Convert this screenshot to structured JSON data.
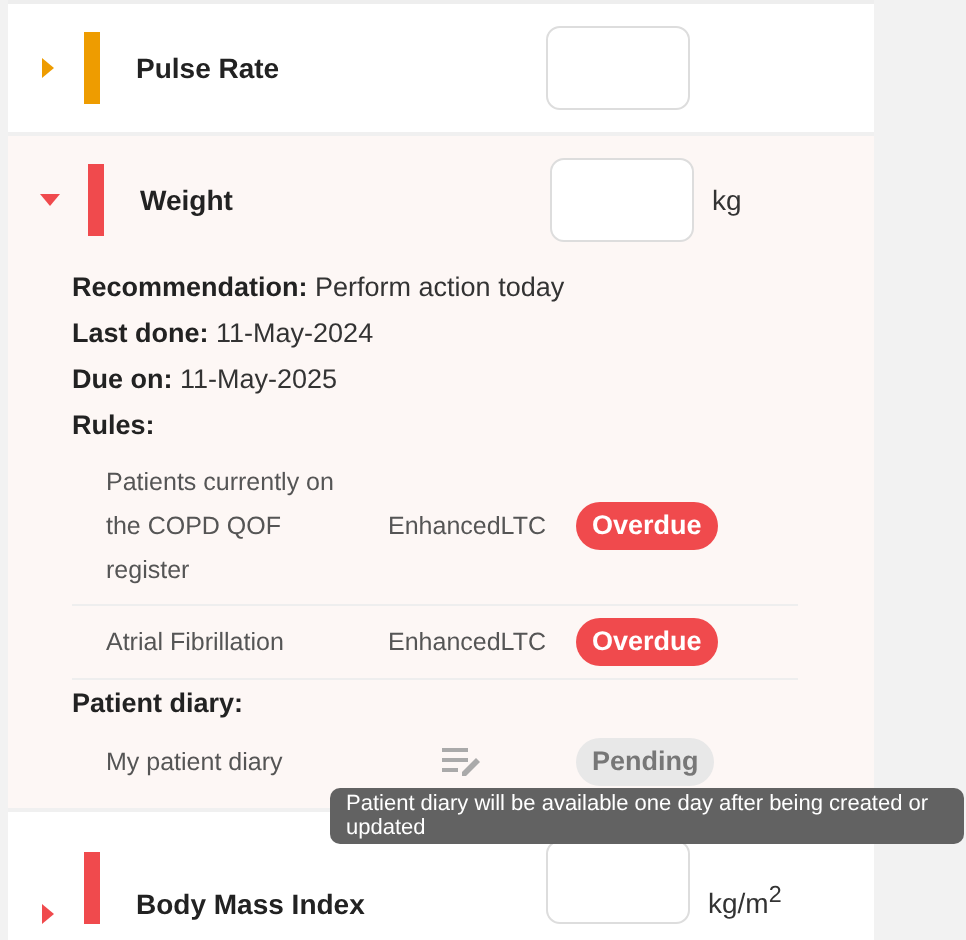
{
  "metrics": [
    {
      "label": "Pulse Rate",
      "color": "#ee9c00",
      "expanded": false
    },
    {
      "label": "Weight",
      "color": "#f04a4d",
      "expanded": true,
      "unit": "kg",
      "details": {
        "fields": [
          {
            "label": "Recommendation:",
            "value": "Perform action today"
          },
          {
            "label": "Last done:",
            "value": "11-May-2024"
          },
          {
            "label": "Due on:",
            "value": "11-May-2025"
          }
        ],
        "rules_heading": "Rules:",
        "rules": [
          {
            "name": "Patients currently on the COPD QOF register",
            "source": "EnhancedLTC",
            "status": "Overdue",
            "kind": "overdue"
          },
          {
            "name": "Atrial Fibrillation",
            "source": "EnhancedLTC",
            "status": "Overdue",
            "kind": "overdue"
          }
        ],
        "diary_heading": "Patient diary:",
        "diary": [
          {
            "name": "My patient diary",
            "status": "Pending",
            "kind": "pending"
          }
        ]
      }
    },
    {
      "label": "Body Mass Index",
      "color": "#f04a4d",
      "expanded": false,
      "unit": "kg/m$^{2}$"
    }
  ],
  "tooltip": "Patient diary will be available one day after being created or updated"
}
